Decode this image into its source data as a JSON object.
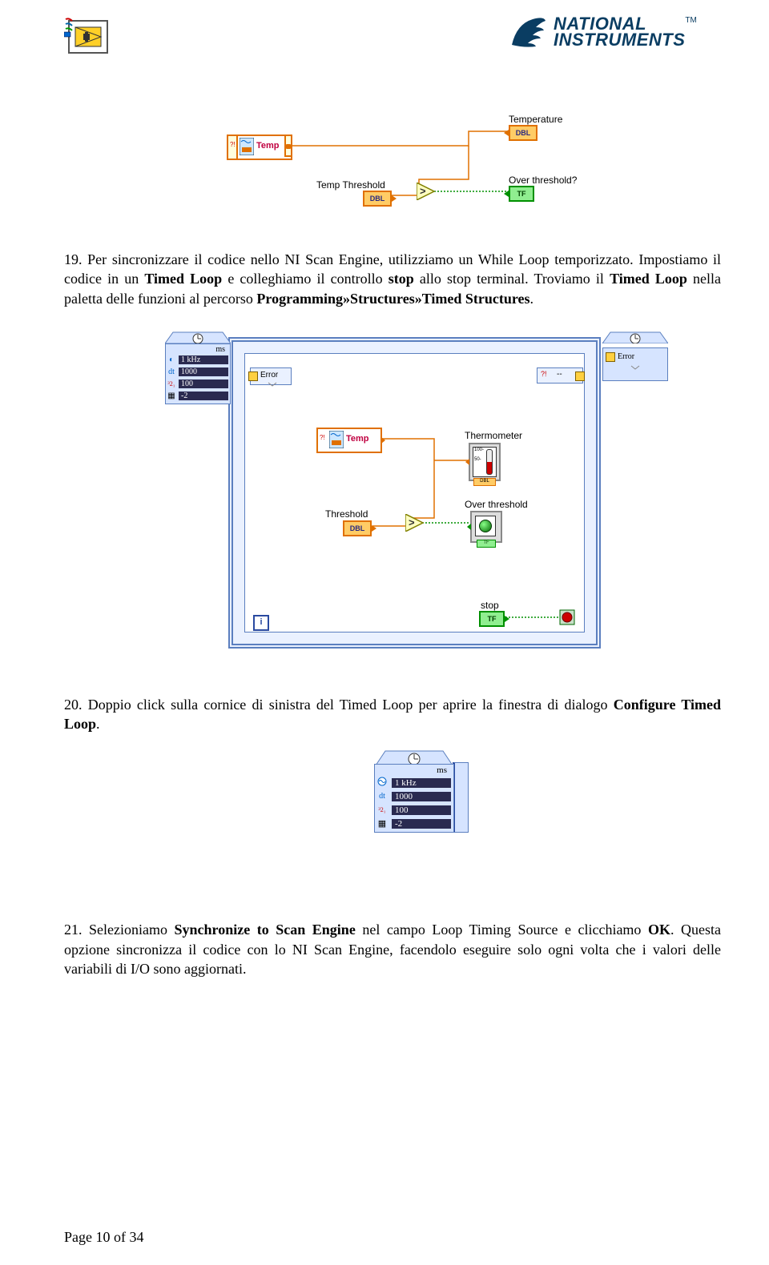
{
  "header": {
    "ni_line1": "NATIONAL",
    "ni_line2": "INSTRUMENTS",
    "tm": "TM"
  },
  "diagram1": {
    "temp_var": "Temp",
    "temperature_label": "Temperature",
    "temperature_type": "DBL",
    "threshold_label": "Temp Threshold",
    "threshold_type": "DBL",
    "over_label": "Over threshold?",
    "over_type": "TF"
  },
  "diagram2": {
    "ms": "ms",
    "src": "1 kHz",
    "dt_label": "dt",
    "dt_val": "1000",
    "phase_val": "100",
    "priority_val": "-2",
    "error_left": "Error",
    "error_right": "Error",
    "dashes": "--",
    "temp_var": "Temp",
    "thermo_label": "Thermometer",
    "threshold_label": "Threshold",
    "threshold_type": "DBL",
    "over_label": "Over threshold",
    "stop_label": "stop",
    "stop_type": "TF",
    "i_label": "i"
  },
  "diagram3": {
    "ms": "ms",
    "src": "1 kHz",
    "dt_label": "dt",
    "dt_val": "1000",
    "phase_val": "100",
    "priority_val": "-2"
  },
  "step19": {
    "num": "19. ",
    "t1": "Per sincronizzare il codice nello NI Scan Engine, utilizziamo un While Loop temporizzato. Impostiamo il codice in un ",
    "b1": "Timed Loop",
    "t2": " e colleghiamo il controllo ",
    "b2": "stop",
    "t3": " allo stop terminal. Troviamo il ",
    "b3": "Timed Loop",
    "t4": " nella paletta delle funzioni al percorso ",
    "b4": "Programming»Structures»Timed Structures",
    "t5": "."
  },
  "step20": {
    "num": "20. ",
    "t1": "Doppio click sulla cornice di sinistra del Timed Loop per aprire la finestra di dialogo ",
    "b1": "Configure Timed Loop",
    "t2": "."
  },
  "step21": {
    "num": "21. ",
    "t1": "Selezioniamo ",
    "b1": "Synchronize to Scan Engine",
    "t2": " nel campo Loop Timing Source e clicchiamo ",
    "b2": "OK",
    "t3": ". Questa opzione sincronizza il codice con lo NI Scan Engine, facendolo eseguire solo ogni volta che i valori delle variabili di I/O sono aggiornati."
  },
  "footer": "Page 10 of 34"
}
